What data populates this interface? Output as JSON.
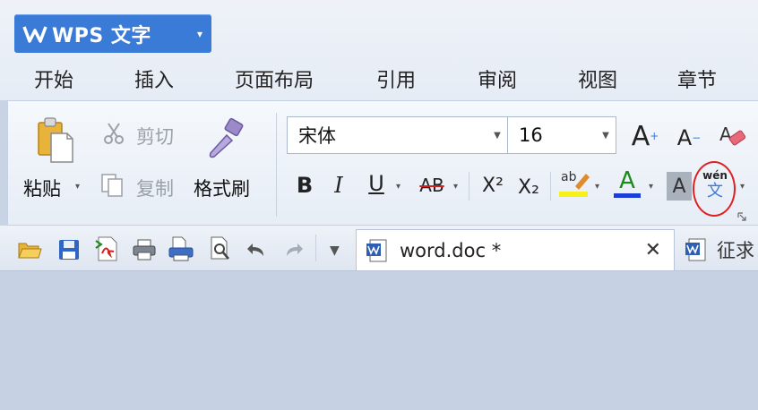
{
  "app": {
    "title": "WPS 文字",
    "menu_caret": "▾",
    "accent": "#3b7bd8"
  },
  "tabs": [
    {
      "label": "开始",
      "active": true
    },
    {
      "label": "插入"
    },
    {
      "label": "页面布局"
    },
    {
      "label": "引用"
    },
    {
      "label": "审阅"
    },
    {
      "label": "视图"
    },
    {
      "label": "章节"
    }
  ],
  "ribbon": {
    "paste_label": "粘贴",
    "cut_label": "剪切",
    "copy_label": "复制",
    "format_painter_label": "格式刷",
    "font_name": "宋体",
    "font_size": "16",
    "bold": "B",
    "italic": "I",
    "underline": "U",
    "strike": "AB",
    "superscript": "X²",
    "subscript": "X₂",
    "phonetic_top": "wén",
    "phonetic_bottom": "文",
    "highlight_text": "ab",
    "font_color_text": "A",
    "char_shading_text": "A",
    "grow_font": "A",
    "shrink_font": "A"
  },
  "quick_access": {
    "icons": [
      "open-folder-icon",
      "save-icon",
      "export-pdf-icon",
      "print-icon",
      "print-preview-icon",
      "preview-icon",
      "undo-icon",
      "redo-icon"
    ]
  },
  "document_tabs": [
    {
      "name": "word.doc *",
      "close": "✕"
    },
    {
      "name": "征求"
    }
  ]
}
